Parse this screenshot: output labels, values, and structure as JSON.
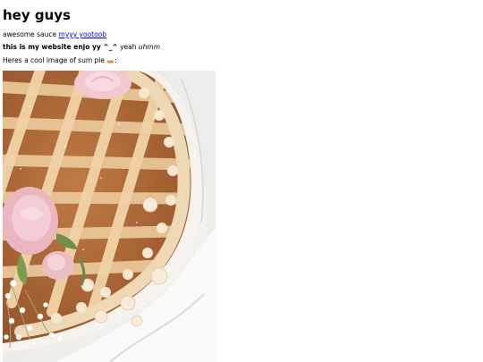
{
  "heading": "hey guys",
  "line1": {
    "prefix": "awesome sauce",
    "link_text": "myyy yootoob"
  },
  "line2": {
    "bold_text": "this is my website enjo yy ^_^",
    "plain_text": "yeah",
    "italic_text": "uhmm"
  },
  "line3": {
    "text": "Heres a cool image of sum pie",
    "emoji": "pie-icon",
    "suffix": ":"
  },
  "image": {
    "subject": "lattice-pie-photo",
    "colors": {
      "crust": "#e9c79a",
      "filling": "#b9743f",
      "cloth": "#f4f3f1",
      "rose": "#f2c9cf"
    }
  }
}
